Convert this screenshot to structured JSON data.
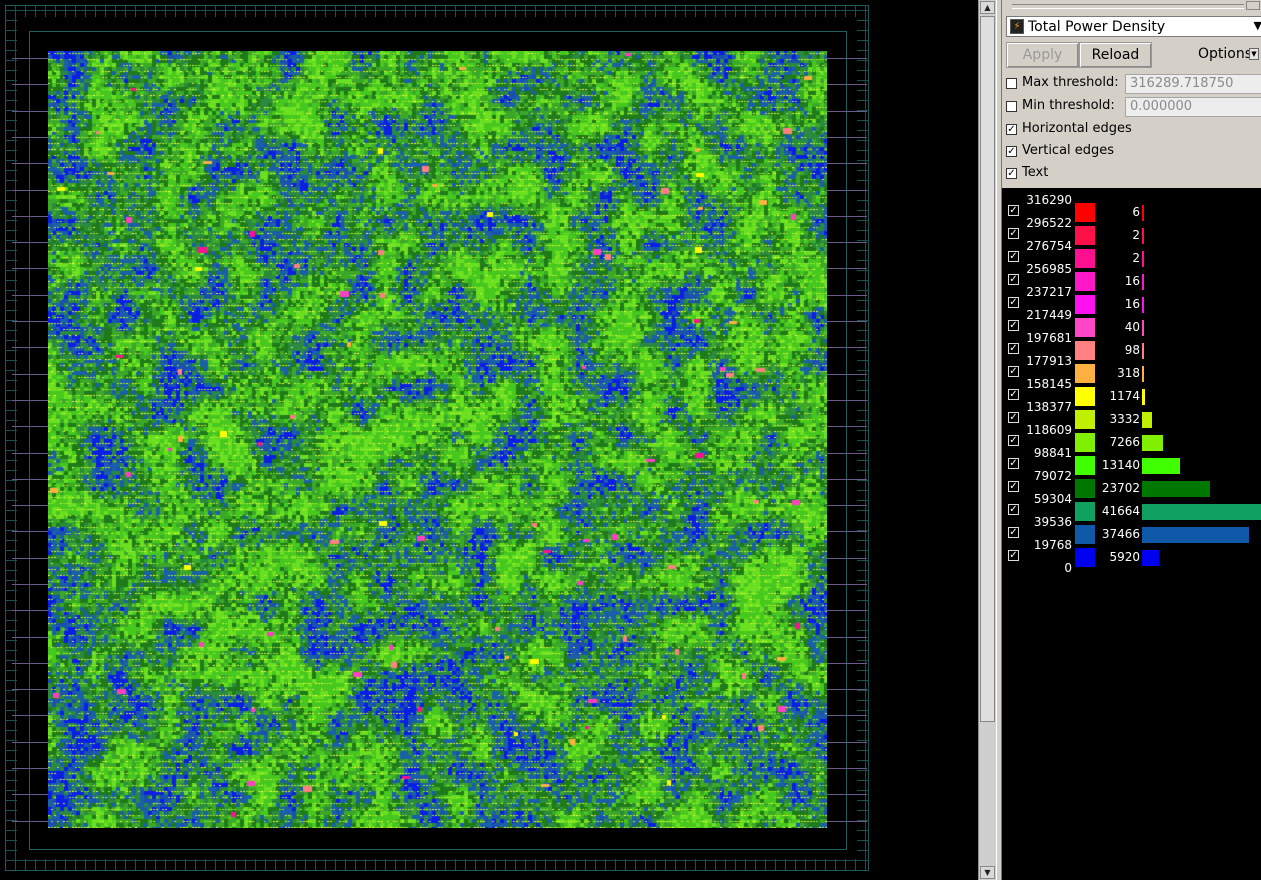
{
  "layer_selector": {
    "selected": "Total Power Density",
    "icon": "heatmap-layer-icon"
  },
  "buttons": {
    "apply": "Apply",
    "reload": "Reload",
    "options": "Options:"
  },
  "thresholds": {
    "max_label": "Max threshold:",
    "max_value": "316289.718750",
    "max_checked": false,
    "min_label": "Min threshold:",
    "min_value": "0.000000",
    "min_checked": false
  },
  "toggles": [
    {
      "label": "Horizontal edges",
      "checked": true
    },
    {
      "label": "Vertical edges",
      "checked": true
    },
    {
      "label": "Text",
      "checked": true
    }
  ],
  "legend": {
    "boundaries": [
      "316290",
      "296522",
      "276754",
      "256985",
      "237217",
      "217449",
      "197681",
      "177913",
      "158145",
      "138377",
      "118609",
      "98841",
      "79072",
      "59304",
      "39536",
      "19768",
      "0"
    ],
    "bins": [
      {
        "color": "#ff0000",
        "count": "6"
      },
      {
        "color": "#ff1048",
        "count": "2"
      },
      {
        "color": "#ff1090",
        "count": "2"
      },
      {
        "color": "#ff18c8",
        "count": "16"
      },
      {
        "color": "#ff10f0",
        "count": "16"
      },
      {
        "color": "#ff48c8",
        "count": "40"
      },
      {
        "color": "#ff8080",
        "count": "98"
      },
      {
        "color": "#ffb040",
        "count": "318"
      },
      {
        "color": "#ffff00",
        "count": "1174"
      },
      {
        "color": "#c0f000",
        "count": "3332"
      },
      {
        "color": "#80f000",
        "count": "7266"
      },
      {
        "color": "#40ff00",
        "count": "13140"
      },
      {
        "color": "#007800",
        "count": "23702"
      },
      {
        "color": "#10a060",
        "count": "41664"
      },
      {
        "color": "#1058a8",
        "count": "37466"
      },
      {
        "color": "#0000f0",
        "count": "5920"
      }
    ]
  },
  "colors": {
    "panel_bg": "#d4d0c8",
    "canvas_bg": "#000000",
    "heat_base": "#3c9a20"
  }
}
